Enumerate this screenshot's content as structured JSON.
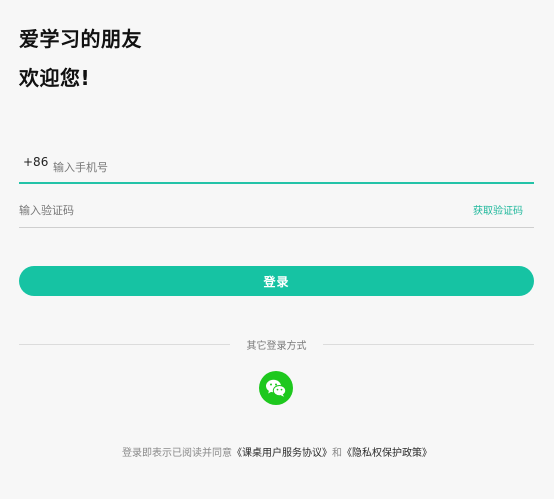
{
  "header": {
    "greeting_line1": "爱学习的朋友",
    "greeting_line2": "欢迎您!"
  },
  "phone": {
    "country_code": "+86",
    "placeholder": "输入手机号"
  },
  "code": {
    "placeholder": "输入验证码",
    "get_code_label": "获取验证码"
  },
  "login_label": "登录",
  "other_methods_label": "其它登录方式",
  "social": {
    "wechat_icon": "wechat-icon",
    "color": "#1ec81e"
  },
  "agreement": {
    "prefix": "登录即表示已阅读并同意",
    "terms_link": "《课桌用户服务协议》",
    "conjunction": "和",
    "privacy_link": "《隐私权保护政策》"
  },
  "colors": {
    "accent": "#16c3a3",
    "link": "#1fb89c",
    "background": "#f7f7f7"
  }
}
